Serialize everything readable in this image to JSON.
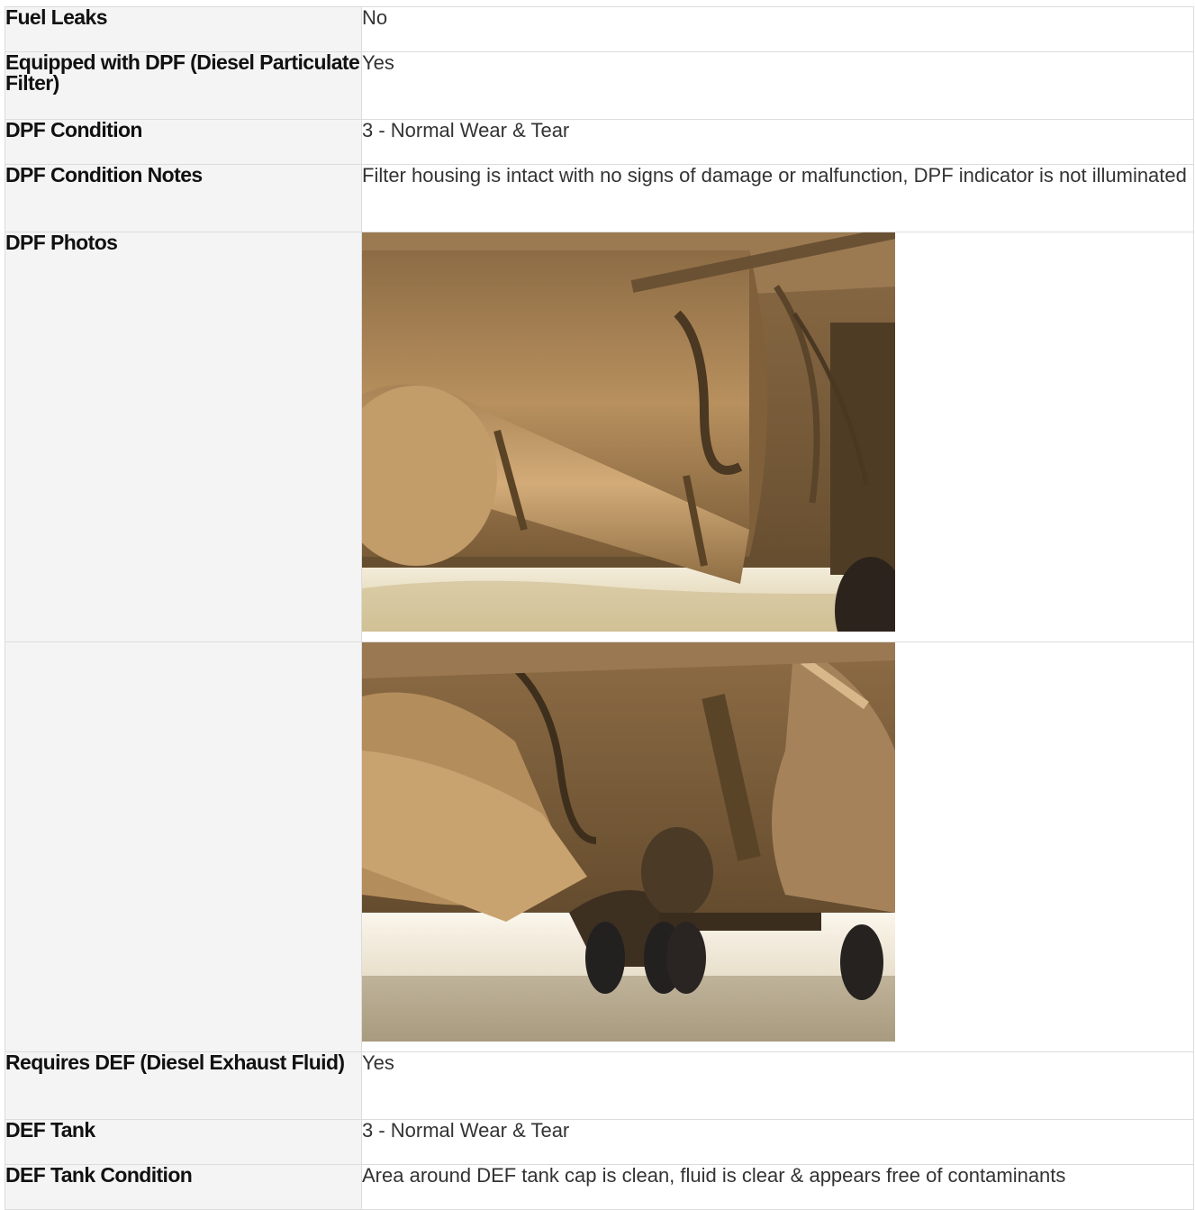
{
  "rows": {
    "fuel_leaks": {
      "label": "Fuel Leaks",
      "value": "No"
    },
    "dpf_equipped": {
      "label": "Equipped with DPF (Diesel Particulate Filter)",
      "value": "Yes"
    },
    "dpf_condition": {
      "label": "DPF Condition",
      "value": "3 - Normal Wear & Tear"
    },
    "dpf_notes": {
      "label": "DPF Condition Notes",
      "value": "Filter housing is intact with no signs of damage or malfunction, DPF indicator is not illuminated"
    },
    "dpf_photos": {
      "label": "DPF Photos"
    },
    "requires_def": {
      "label": "Requires DEF (Diesel Exhaust Fluid)",
      "value": "Yes"
    },
    "def_tank": {
      "label": "DEF Tank",
      "value": "3 - Normal Wear & Tear"
    },
    "def_tank_condition": {
      "label": "DEF Tank Condition",
      "value": "Area around DEF tank cap is clean, fluid is clear & appears free of contaminants"
    }
  },
  "photos": [
    {
      "subject": "truck-underside-dpf-exhaust-photo"
    },
    {
      "subject": "truck-underside-chassis-photo"
    }
  ]
}
